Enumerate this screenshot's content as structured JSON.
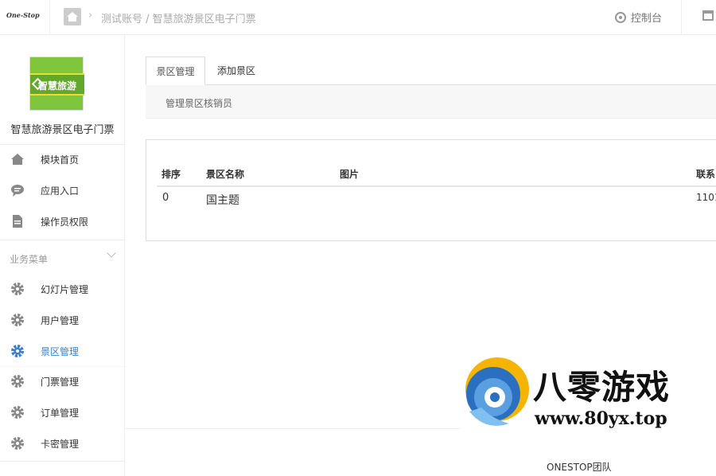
{
  "topbar": {
    "logo_text": "One-Stop",
    "breadcrumb": "测试账号 / 智慧旅游景区电子门票",
    "console_label": "控制台"
  },
  "sidebar": {
    "app_logo_text": "智慧旅游",
    "app_name": "智慧旅游景区电子门票",
    "top_items": [
      {
        "label": "模块首页",
        "icon": "home-icon"
      },
      {
        "label": "应用入口",
        "icon": "chat-icon"
      },
      {
        "label": "操作员权限",
        "icon": "document-icon"
      }
    ],
    "section_title": "业务菜单",
    "business_items": [
      {
        "label": "幻灯片管理",
        "icon": "gear-icon"
      },
      {
        "label": "用户管理",
        "icon": "gear-icon"
      },
      {
        "label": "景区管理",
        "icon": "gear-icon",
        "active": true
      },
      {
        "label": "门票管理",
        "icon": "gear-icon"
      },
      {
        "label": "订单管理",
        "icon": "gear-icon"
      },
      {
        "label": "卡密管理",
        "icon": "gear-icon"
      }
    ]
  },
  "main": {
    "tabs": [
      {
        "label": "景区管理",
        "active": true
      },
      {
        "label": "添加景区",
        "active": false
      }
    ],
    "subnav_link": "管理景区核销员",
    "table": {
      "headers": [
        "排序",
        "景区名称",
        "图片",
        "联系"
      ],
      "rows": [
        [
          "0",
          "国主题",
          "",
          "1101"
        ]
      ]
    }
  },
  "footer": {
    "text": "ONESTOP团队"
  },
  "watermark": {
    "title": "八零游戏",
    "url": "www.80yx.top"
  },
  "colors": {
    "accent": "#3a7fc8",
    "logo_green": "#7fc63c"
  }
}
